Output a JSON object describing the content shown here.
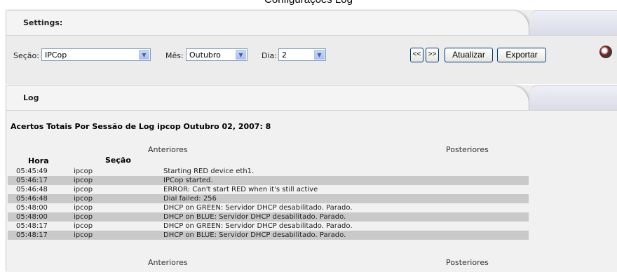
{
  "window_title": "Configurações Log",
  "settings": {
    "title": "Settings:",
    "section_label": "Seção:",
    "section_value": "IPCop",
    "month_label": "Mês:",
    "month_value": "Outubro",
    "day_label": "Dia:",
    "day_value": "2",
    "prev_label": "<<",
    "next_label": ">>",
    "refresh_label": "Atualizar",
    "export_label": "Exportar"
  },
  "log": {
    "title": "Log",
    "heading": "Acertos Totais Por Sessão de Log ipcop Outubro 02, 2007: 8",
    "prev_link": "Anteriores",
    "next_link": "Posteriores",
    "columns": [
      "Hora",
      "Seção"
    ],
    "rows": [
      {
        "time": "05:45:49",
        "section": "ipcop",
        "message": "Starting RED device eth1."
      },
      {
        "time": "05:46:17",
        "section": "ipcop",
        "message": "IPCop started."
      },
      {
        "time": "05:46:48",
        "section": "ipcop",
        "message": "ERROR: Can't start RED when it's still active"
      },
      {
        "time": "05:46:48",
        "section": "ipcop",
        "message": "Dial failed: 256"
      },
      {
        "time": "05:48:00",
        "section": "ipcop",
        "message": "DHCP on GREEN: Servidor DHCP desabilitado. Parado."
      },
      {
        "time": "05:48:00",
        "section": "ipcop",
        "message": "DHCP on BLUE: Servidor DHCP desabilitado. Parado."
      },
      {
        "time": "05:48:17",
        "section": "ipcop",
        "message": "DHCP on GREEN: Servidor DHCP desabilitado. Parado."
      },
      {
        "time": "05:48:17",
        "section": "ipcop",
        "message": "DHCP on BLUE: Servidor DHCP desabilitado. Parado."
      }
    ]
  },
  "colors": {
    "alt_row": "#c9c9c9",
    "panel": "#ececec",
    "button_border": "#003c74"
  }
}
